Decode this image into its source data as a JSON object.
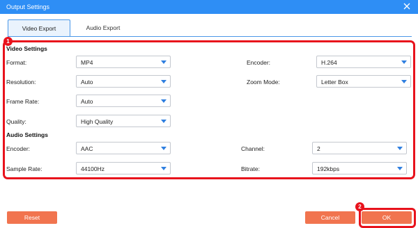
{
  "window": {
    "title": "Output Settings"
  },
  "tabs": [
    {
      "label": "Video Export",
      "active": true
    },
    {
      "label": "Audio Export",
      "active": false
    }
  ],
  "video_settings": {
    "heading": "Video Settings",
    "format": {
      "label": "Format:",
      "value": "MP4"
    },
    "resolution": {
      "label": "Resolution:",
      "value": "Auto"
    },
    "frame_rate": {
      "label": "Frame Rate:",
      "value": "Auto"
    },
    "quality": {
      "label": "Quality:",
      "value": "High Quality"
    },
    "encoder": {
      "label": "Encoder:",
      "value": "H.264"
    },
    "zoom_mode": {
      "label": "Zoom Mode:",
      "value": "Letter Box"
    }
  },
  "audio_settings": {
    "heading": "Audio Settings",
    "encoder": {
      "label": "Encoder:",
      "value": "AAC"
    },
    "sample_rate": {
      "label": "Sample Rate:",
      "value": "44100Hz"
    },
    "channel": {
      "label": "Channel:",
      "value": "2"
    },
    "bitrate": {
      "label": "Bitrate:",
      "value": "192kbps"
    }
  },
  "badges": {
    "one": "1",
    "two": "2"
  },
  "buttons": {
    "reset": "Reset",
    "cancel": "Cancel",
    "ok": "OK"
  },
  "colors": {
    "titlebar": "#2e8ef5",
    "accent_button": "#f1744f",
    "highlight": "#e8121c"
  }
}
